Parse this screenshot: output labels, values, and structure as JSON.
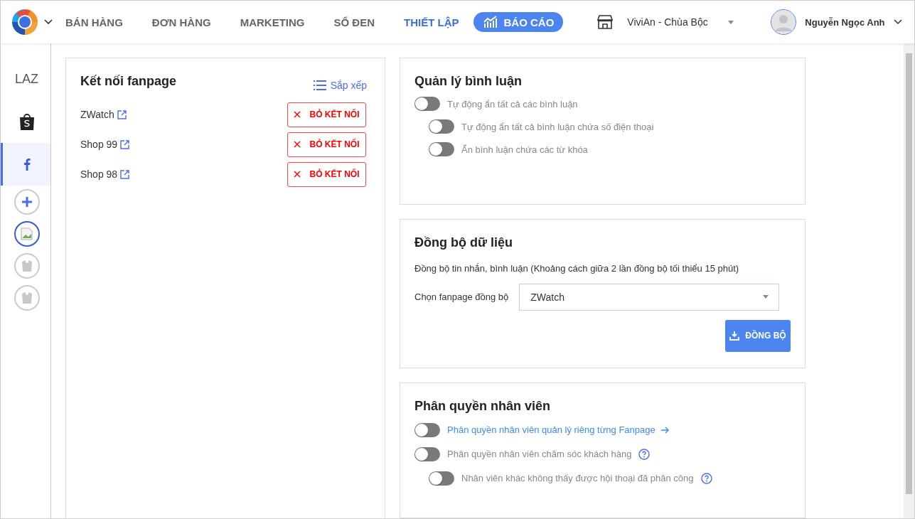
{
  "nav": {
    "items": [
      {
        "label": "BÁN HÀNG",
        "kind": "link",
        "selected": false
      },
      {
        "label": "ĐƠN HÀNG",
        "kind": "link",
        "selected": false
      },
      {
        "label": "MARKETING",
        "kind": "link",
        "selected": false
      },
      {
        "label": "SỔ ĐEN",
        "kind": "link",
        "selected": false
      },
      {
        "label": "THIẾT LẬP",
        "kind": "link",
        "selected": true
      },
      {
        "label": "BÁO CÁO",
        "kind": "pill",
        "selected": false
      }
    ],
    "store": "ViviAn - Chùa Bộc",
    "user": "Nguyễn Ngọc Anh"
  },
  "sidebar": [
    {
      "kind": "text",
      "label": "LAZ",
      "selected": false
    },
    {
      "kind": "shopee",
      "selected": false
    },
    {
      "kind": "facebook",
      "selected": true
    },
    {
      "kind": "add",
      "selected": false
    },
    {
      "kind": "broken",
      "selected": false
    },
    {
      "kind": "bag",
      "selected": false
    },
    {
      "kind": "bag",
      "selected": false
    }
  ],
  "fanpages": {
    "title": "Kết nối fanpage",
    "sort": "Sắp xếp",
    "pages": [
      {
        "name": "ZWatch",
        "action": "BỎ KẾT NỐI"
      },
      {
        "name": "Shop 99",
        "action": "BỎ KẾT NỐI"
      },
      {
        "name": "Shop 98",
        "action": "BỎ KẾT NỐI"
      }
    ]
  },
  "comments": {
    "title": "Quản lý bình luận",
    "toggles": [
      {
        "label": "Tự động ẩn tất cả các bình luận",
        "kind": "plain",
        "on": false,
        "children": [
          {
            "label": "Tự động ẩn tất cả bình luận chứa số điện thoại",
            "kind": "plain",
            "on": false
          },
          {
            "label": "Ẩn bình luận chứa các từ khóa",
            "kind": "plain",
            "on": false
          }
        ]
      }
    ]
  },
  "sync": {
    "title": "Đồng bộ dữ liệu",
    "description": "Đồng bộ tin nhắn, bình luận (Khoảng cách giữa 2 lần đồng bộ tối thiểu 15 phút)",
    "select_label": "Chọn fanpage đồng bộ",
    "select_value": "ZWatch",
    "button": "ĐỒNG BỘ"
  },
  "permissions": {
    "title": "Phân quyền nhân viên",
    "toggles": [
      {
        "label": "Phân quyền nhân viên quản lý riêng từng Fanpage",
        "kind": "link",
        "on": false
      },
      {
        "label": "Phân quyền nhân viên chăm sóc khách hàng",
        "kind": "help",
        "on": false,
        "children": [
          {
            "label": "Nhân viên khác không thấy được hội thoại đã phân công",
            "kind": "help",
            "on": false
          }
        ]
      }
    ]
  }
}
